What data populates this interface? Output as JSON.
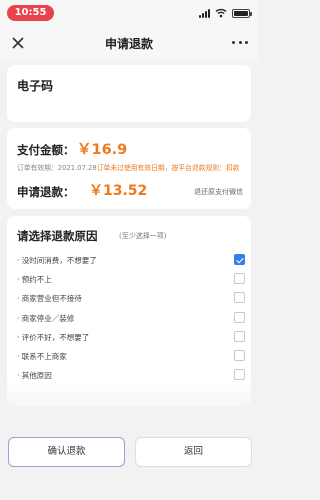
{
  "status_bar": {
    "time": "10:55"
  },
  "nav": {
    "title": "申请退款"
  },
  "product": {
    "name": "电子码"
  },
  "payment": {
    "label": "支付金额：",
    "amount": "￥16.9",
    "note_prefix": "订单有效期：2021.07.28",
    "note_warn": "订单未过使用有效日期，按平台退款规则：扣款20%违约金"
  },
  "refund": {
    "label": "申请退款：",
    "amount": "￥13.52",
    "destination": "退还原支付微信"
  },
  "reasons": {
    "title": "请选择退款原因",
    "hint": "(至少选择一项)",
    "items": [
      {
        "label": "· 没时间消费，不想要了",
        "checked": true
      },
      {
        "label": "· 预约不上",
        "checked": false
      },
      {
        "label": "· 商家营业但不接待",
        "checked": false
      },
      {
        "label": "· 商家停业／装修",
        "checked": false
      },
      {
        "label": "· 评价不好，不想要了",
        "checked": false
      },
      {
        "label": "· 联系不上商家",
        "checked": false
      },
      {
        "label": "· 其他原因",
        "checked": false
      }
    ]
  },
  "actions": {
    "confirm": "确认退款",
    "back": "返回"
  }
}
